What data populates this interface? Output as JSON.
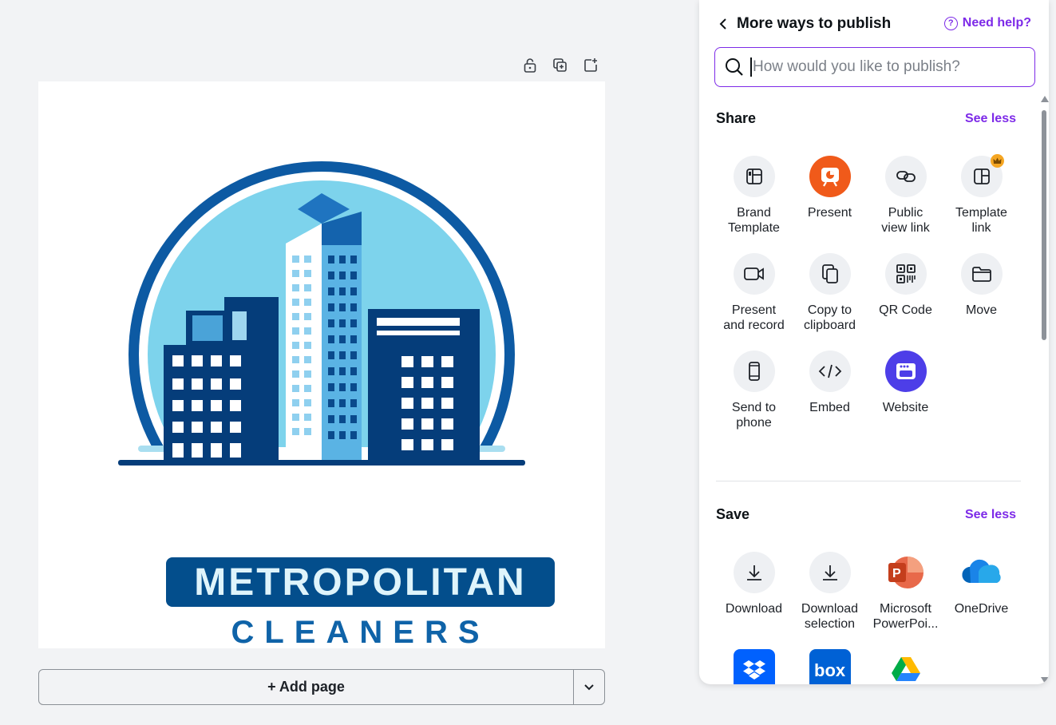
{
  "canvas": {
    "tools": [
      {
        "name": "lock-icon"
      },
      {
        "name": "duplicate-page-icon"
      },
      {
        "name": "add-page-icon"
      }
    ],
    "logo": {
      "line1": "METROPOLITAN",
      "line2": "CLEANERS",
      "colors": {
        "navy": "#034e8c",
        "blue": "#0f63a8",
        "sky": "#7dd3ec",
        "light": "#dff4fb"
      }
    },
    "add_page_label": "+ Add page"
  },
  "panel": {
    "title": "More ways to publish",
    "help": "Need help?",
    "search_placeholder": "How would you like to publish?",
    "accent": "#7d2ae8",
    "share": {
      "title": "Share",
      "see_less": "See less",
      "items": [
        {
          "label": "Brand\nTemplate",
          "icon": "brand-template-icon"
        },
        {
          "label": "Present",
          "icon": "present-icon"
        },
        {
          "label": "Public\nview link",
          "icon": "link-icon"
        },
        {
          "label": "Template\nlink",
          "icon": "template-link-icon"
        },
        {
          "label": "Present\nand record",
          "icon": "video-camera-icon"
        },
        {
          "label": "Copy to\nclipboard",
          "icon": "copy-icon"
        },
        {
          "label": "QR Code",
          "icon": "qr-code-icon"
        },
        {
          "label": "Move",
          "icon": "folder-icon"
        },
        {
          "label": "Send to\nphone",
          "icon": "phone-icon"
        },
        {
          "label": "Embed",
          "icon": "embed-code-icon"
        },
        {
          "label": "Website",
          "icon": "website-icon"
        }
      ]
    },
    "save": {
      "title": "Save",
      "see_less": "See less",
      "items": [
        {
          "label": "Download",
          "icon": "download-icon"
        },
        {
          "label": "Download\nselection",
          "icon": "download-selection-icon"
        },
        {
          "label": "Microsoft\nPowerPoi...",
          "icon": "powerpoint-icon"
        },
        {
          "label": "OneDrive",
          "icon": "onedrive-icon"
        },
        {
          "label": "",
          "icon": "dropbox-icon"
        },
        {
          "label": "",
          "icon": "box-icon"
        },
        {
          "label": "",
          "icon": "google-drive-icon"
        }
      ]
    }
  }
}
